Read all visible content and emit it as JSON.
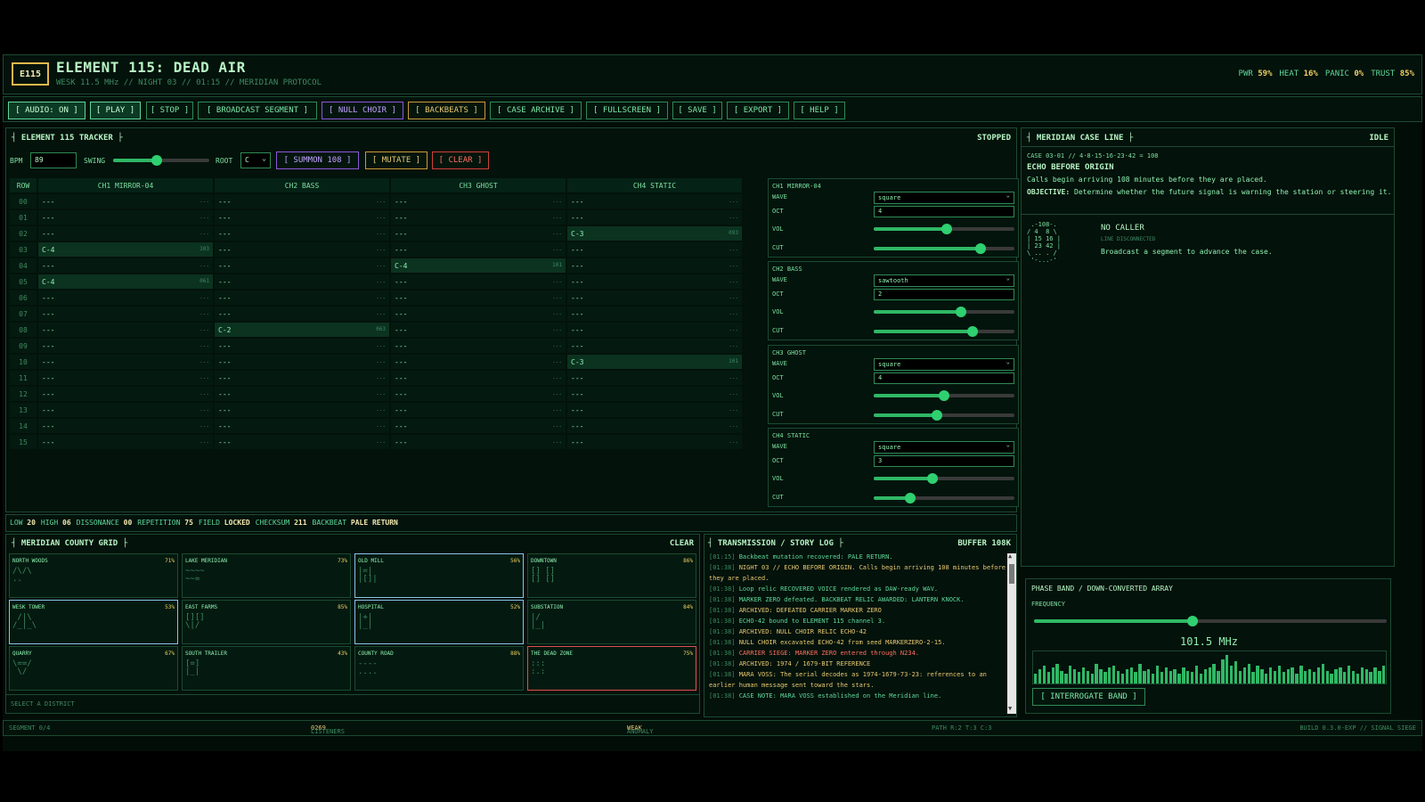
{
  "header": {
    "logo": "E115",
    "title": "ELEMENT 115: DEAD AIR",
    "subtitle": "WESK 11.5 MHz // NIGHT 03 // 01:15 // MERIDIAN PROTOCOL",
    "stats": [
      {
        "label": "PWR",
        "value": "59%"
      },
      {
        "label": "HEAT",
        "value": "16%"
      },
      {
        "label": "PANIC",
        "value": "0%"
      },
      {
        "label": "TRUST",
        "value": "85%"
      }
    ]
  },
  "toolbar": [
    "[ AUDIO: ON ]",
    "[ PLAY ]",
    "[ STOP ]",
    "[ BROADCAST SEGMENT ]",
    "[ NULL CHOIR ]",
    "[ BACKBEATS ]",
    "[ CASE ARCHIVE ]",
    "[ FULLSCREEN ]",
    "[ SAVE ]",
    "[ EXPORT ]",
    "[ HELP ]"
  ],
  "tracker": {
    "title": "┤ ELEMENT 115 TRACKER ├",
    "state": "STOPPED",
    "bpm_label": "BPM",
    "bpm": "89",
    "swing_label": "SWING",
    "swing": 0.45,
    "root_label": "ROOT",
    "root": "C",
    "summon": "[ SUMMON 108 ]",
    "mutate": "[ MUTATE ]",
    "clear": "[ CLEAR ]",
    "columns": [
      "ROW",
      "CH1 MIRROR-04",
      "CH2 BASS",
      "CH3 GHOST",
      "CH4 STATIC"
    ],
    "rows": [
      [
        "00",
        "---",
        "---",
        "---",
        "---"
      ],
      [
        "01",
        "---",
        "---",
        "---",
        "---"
      ],
      [
        "02",
        "---",
        "---",
        "---",
        "C-3"
      ],
      [
        "03",
        "C-4",
        "---",
        "---",
        "---"
      ],
      [
        "04",
        "---",
        "---",
        "C-4",
        "---"
      ],
      [
        "05",
        "C-4",
        "---",
        "---",
        "---"
      ],
      [
        "06",
        "---",
        "---",
        "---",
        "---"
      ],
      [
        "07",
        "---",
        "---",
        "---",
        "---"
      ],
      [
        "08",
        "---",
        "C-2",
        "---",
        "---"
      ],
      [
        "09",
        "---",
        "---",
        "---",
        "---"
      ],
      [
        "10",
        "---",
        "---",
        "---",
        "C-3"
      ],
      [
        "11",
        "---",
        "---",
        "---",
        "---"
      ],
      [
        "12",
        "---",
        "---",
        "---",
        "---"
      ],
      [
        "13",
        "---",
        "---",
        "---",
        "---"
      ],
      [
        "14",
        "---",
        "---",
        "---",
        "---"
      ],
      [
        "15",
        "---",
        "---",
        "---",
        "---"
      ]
    ],
    "cell_vals": {
      "02-4": "093",
      "03-1": "103",
      "04-3": "101",
      "05-1": "061",
      "08-2": "063",
      "10-4": "101"
    },
    "empty_val": "...",
    "status": [
      {
        "label": "LOW",
        "value": "20"
      },
      {
        "label": "HIGH",
        "value": "06"
      },
      {
        "label": "DISSONANCE",
        "value": "00"
      },
      {
        "label": "REPETITION",
        "value": "75"
      },
      {
        "label": "FIELD",
        "value": "LOCKED"
      },
      {
        "label": "CHECKSUM",
        "value": "211"
      },
      {
        "label": "BACKBEAT",
        "value": "PALE RETURN"
      }
    ]
  },
  "channels": [
    {
      "name": "CH1 MIRROR-04",
      "wave": "square",
      "oct": "4",
      "vol": 0.52,
      "cut": 0.76
    },
    {
      "name": "CH2 BASS",
      "wave": "sawtooth",
      "oct": "2",
      "vol": 0.62,
      "cut": 0.7
    },
    {
      "name": "CH3 GHOST",
      "wave": "square",
      "oct": "4",
      "vol": 0.5,
      "cut": 0.45
    },
    {
      "name": "CH4 STATIC",
      "wave": "square",
      "oct": "3",
      "vol": 0.42,
      "cut": 0.26
    }
  ],
  "ch_labels": {
    "wave": "WAVE",
    "oct": "OCT",
    "vol": "VOL",
    "cut": "CUT"
  },
  "case": {
    "title": "┤ MERIDIAN CASE LINE ├",
    "state": "IDLE",
    "id": "CASE 03-01 // 4·8·15·16·23·42 = 108",
    "name": "ECHO BEFORE ORIGIN",
    "desc": "Calls begin arriving 108 minutes before they are placed.",
    "obj_label": "OBJECTIVE:",
    "objective": "Determine whether the future signal is warning the station or steering it.",
    "caller": "NO CALLER",
    "caller_status": "LINE DISCONNECTED",
    "caller_msg": "Broadcast a segment to advance the case.",
    "glyph": " .-108-.\n/ 4  8 \\\n| 15 16 |\n| 23 42 |\n\\ .. . /\n '-...-'"
  },
  "grid": {
    "title": "┤ MERIDIAN COUNTY GRID ├",
    "clear": "CLEAR",
    "hint": "SELECT A DISTRICT",
    "districts": [
      {
        "name": "NORTH WOODS",
        "pct": "71%",
        "glyph": "/\\/\\\n.."
      },
      {
        "name": "LAKE MERIDIAN",
        "pct": "73%",
        "glyph": "~~~~\n~~="
      },
      {
        "name": "OLD MILL",
        "pct": "56%",
        "glyph": "|=|\n|[]|"
      },
      {
        "name": "DOWNTOWN",
        "pct": "86%",
        "glyph": "[] []\n[] []"
      },
      {
        "name": "WESK TOWER",
        "pct": "53%",
        "glyph": " /|\\\n/_|_\\"
      },
      {
        "name": "EAST FARMS",
        "pct": "85%",
        "glyph": "[][]\n\\|/"
      },
      {
        "name": "HOSPITAL",
        "pct": "52%",
        "glyph": "|+|\n|_|"
      },
      {
        "name": "SUBSTATION",
        "pct": "84%",
        "glyph": "|/\n|_|"
      },
      {
        "name": "QUARRY",
        "pct": "67%",
        "glyph": "\\==/\n \\/"
      },
      {
        "name": "SOUTH TRAILER",
        "pct": "43%",
        "glyph": "[=]\n|_|"
      },
      {
        "name": "COUNTY ROAD",
        "pct": "88%",
        "glyph": "----\n...."
      },
      {
        "name": "THE DEAD ZONE",
        "pct": "75%",
        "glyph": ":::\n:.:"
      }
    ]
  },
  "log": {
    "title": "┤ TRANSMISSION / STORY LOG ├",
    "buffer": "BUFFER 108K",
    "entries": [
      {
        "t": "[01:15]",
        "msg": "Backbeat mutation recovered: PALE RETURN.",
        "c": ""
      },
      {
        "t": "[01:38]",
        "msg": "NIGHT 03 // ECHO BEFORE ORIGIN. Calls begin arriving 108 minutes before they are placed.",
        "c": "y"
      },
      {
        "t": "[01:38]",
        "msg": "Loop relic RECOVERED VOICE rendered as DAW-ready WAV.",
        "c": ""
      },
      {
        "t": "[01:38]",
        "msg": "MARKER ZERO defeated. BACKBEAT RELIC AWARDED: LANTERN KNOCK.",
        "c": ""
      },
      {
        "t": "[01:38]",
        "msg": "ARCHIVED: DEFEATED CARRIER MARKER ZERO",
        "c": "y"
      },
      {
        "t": "[01:38]",
        "msg": "ECHO-42 bound to ELEMENT 115 channel 3.",
        "c": ""
      },
      {
        "t": "[01:38]",
        "msg": "ARCHIVED: NULL CHOIR RELIC ECHO-42",
        "c": "y"
      },
      {
        "t": "[01:38]",
        "msg": "NULL CHOIR excavated ECHO-42 from seed MARKERZERO-2-15.",
        "c": "y"
      },
      {
        "t": "[01:38]",
        "msg": "CARRIER SIEGE: MARKER ZERO entered through N234.",
        "c": "rd"
      },
      {
        "t": "[01:38]",
        "msg": "ARCHIVED: 1974 / 1679-BIT REFERENCE",
        "c": "y"
      },
      {
        "t": "[01:38]",
        "msg": "MARA VOSS: The serial decodes as 1974-1679-73-23: references to an earlier human message sent toward the stars.",
        "c": "y"
      },
      {
        "t": "[01:38]",
        "msg": "CASE NOTE: MARA VOSS established on the Meridian line.",
        "c": ""
      }
    ]
  },
  "phase": {
    "title": "PHASE BAND / DOWN-CONVERTED ARRAY",
    "freq_label": "FREQUENCY",
    "freq_pos": 0.45,
    "freq": "101.5 MHz",
    "button": "[ INTERROGATE BAND ]",
    "bars": [
      0.3,
      0.45,
      0.55,
      0.35,
      0.5,
      0.6,
      0.4,
      0.3,
      0.55,
      0.45,
      0.35,
      0.5,
      0.4,
      0.3,
      0.6,
      0.45,
      0.35,
      0.5,
      0.55,
      0.4,
      0.3,
      0.45,
      0.5,
      0.35,
      0.6,
      0.4,
      0.45,
      0.3,
      0.55,
      0.35,
      0.5,
      0.4,
      0.45,
      0.3,
      0.5,
      0.4,
      0.35,
      0.55,
      0.3,
      0.45,
      0.5,
      0.6,
      0.4,
      0.75,
      0.9,
      0.55,
      0.7,
      0.4,
      0.5,
      0.6,
      0.35,
      0.55,
      0.45,
      0.3,
      0.5,
      0.4,
      0.55,
      0.35,
      0.45,
      0.5,
      0.3,
      0.55,
      0.4,
      0.45,
      0.35,
      0.5,
      0.6,
      0.4,
      0.3,
      0.45,
      0.5,
      0.35,
      0.55,
      0.4,
      0.3,
      0.5,
      0.45,
      0.35,
      0.5,
      0.4,
      0.55
    ]
  },
  "footer": {
    "segment": "SEGMENT 0/4",
    "listeners_label": "LISTENERS",
    "listeners": "0269",
    "anomaly_label": "ANOMALY",
    "anomaly": "WEAK",
    "path": "PATH R:2 T:3 C:3",
    "build": "BUILD 0.3.0-EXP // SIGNAL SIEGE"
  }
}
